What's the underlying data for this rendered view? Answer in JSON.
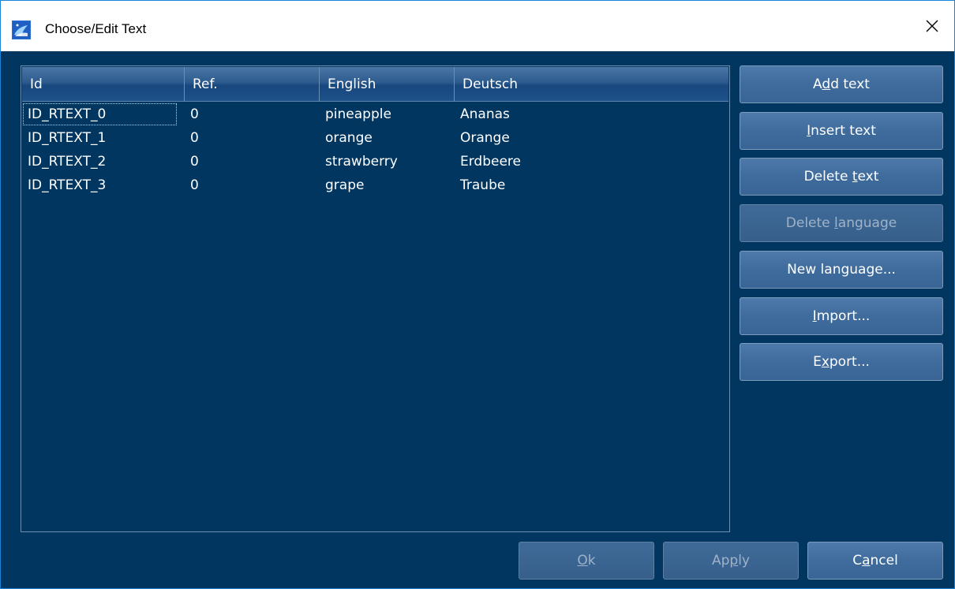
{
  "window": {
    "title": "Choose/Edit Text"
  },
  "table": {
    "columns": [
      "Id",
      "Ref.",
      "English",
      "Deutsch"
    ],
    "rows": [
      [
        "ID_RTEXT_0",
        "0",
        "pineapple",
        "Ananas"
      ],
      [
        "ID_RTEXT_1",
        "0",
        "orange",
        "Orange"
      ],
      [
        "ID_RTEXT_2",
        "0",
        "strawberry",
        "Erdbeere"
      ],
      [
        "ID_RTEXT_3",
        "0",
        "grape",
        "Traube"
      ]
    ]
  },
  "side_buttons": [
    {
      "pre": "A",
      "mn": "d",
      "post": "d text",
      "enabled": true
    },
    {
      "pre": "",
      "mn": "I",
      "post": "nsert text",
      "enabled": true
    },
    {
      "pre": "Delete ",
      "mn": "t",
      "post": "ext",
      "enabled": true
    },
    {
      "pre": "Delete ",
      "mn": "l",
      "post": "anguage",
      "enabled": false
    },
    {
      "pre": "New language...",
      "mn": "",
      "post": "",
      "enabled": true
    },
    {
      "pre": "",
      "mn": "I",
      "post": "mport...",
      "enabled": true
    },
    {
      "pre": "E",
      "mn": "x",
      "post": "port...",
      "enabled": true
    }
  ],
  "bottom_buttons": [
    {
      "pre": "",
      "mn": "O",
      "post": "k",
      "enabled": false
    },
    {
      "pre": "Ap",
      "mn": "p",
      "post": "ly",
      "enabled": false
    },
    {
      "pre": "C",
      "mn": "a",
      "post": "ncel",
      "enabled": true
    }
  ],
  "colors": {
    "background": "#003660",
    "button": "#3f6c9d",
    "titlebar": "#ffffff",
    "border_accent": "#1883d7"
  }
}
